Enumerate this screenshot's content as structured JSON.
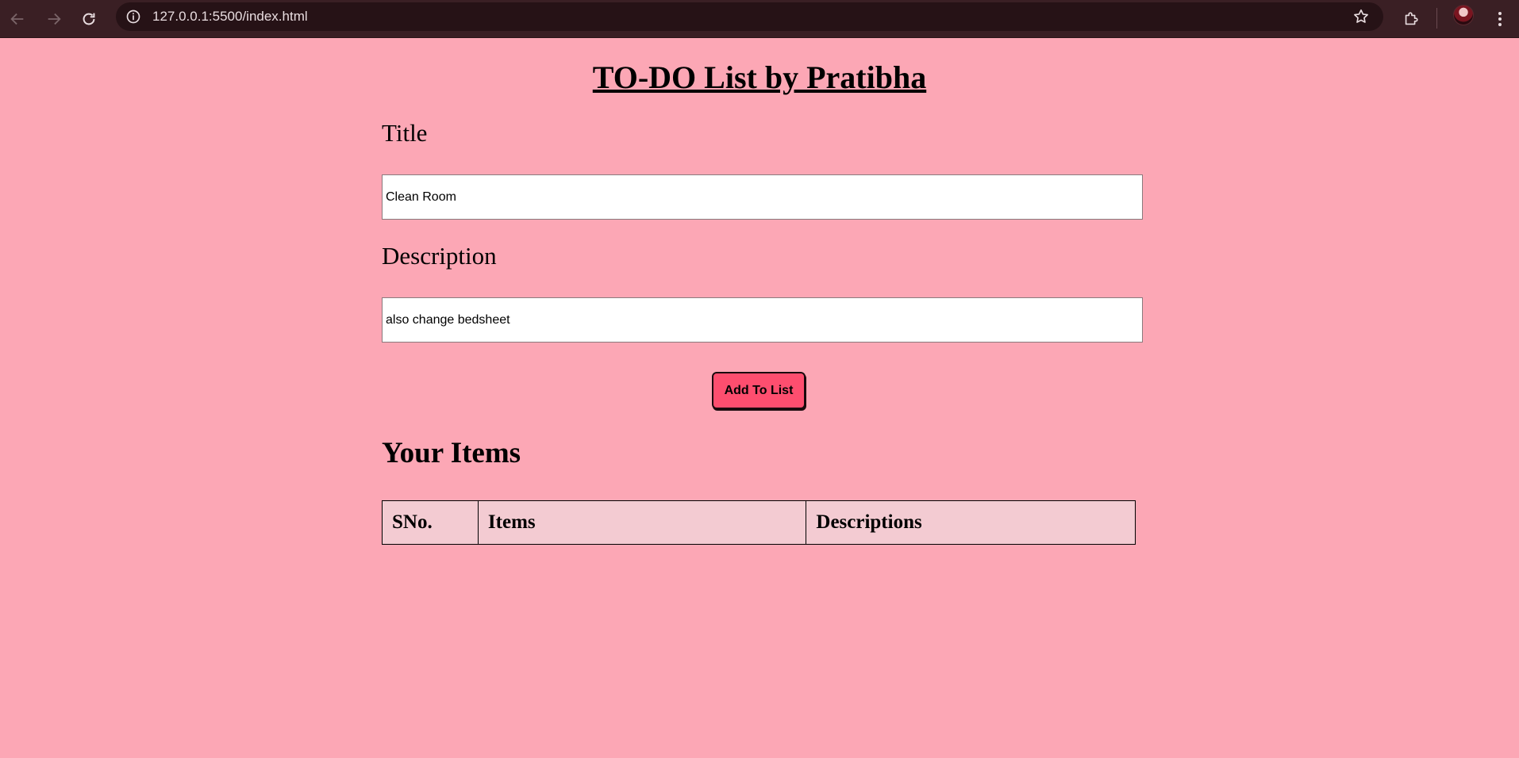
{
  "browser": {
    "url": "127.0.0.1:5500/index.html",
    "icons": {
      "back": "arrow-left-icon",
      "forward": "arrow-right-icon",
      "reload": "reload-icon",
      "site_info": "info-icon",
      "bookmark": "star-icon",
      "extensions": "puzzle-icon",
      "menu": "kebab-menu-icon"
    },
    "colors": {
      "toolbar": "#3a1f24",
      "omnibox": "#261216",
      "icon": "#e8dcdf"
    }
  },
  "page": {
    "title": "TO-DO List by Pratibha",
    "background": "#fca7b5",
    "form": {
      "title_label": "Title",
      "title_value": "Clean Room",
      "description_label": "Description",
      "description_value": "also change bedsheet",
      "add_button_label": "Add To List",
      "add_button_color": "#fe4e6f"
    },
    "items": {
      "heading": "Your Items",
      "table_background": "#f3cbd2",
      "columns": [
        "SNo.",
        "Items",
        "Descriptions"
      ],
      "rows": []
    }
  }
}
